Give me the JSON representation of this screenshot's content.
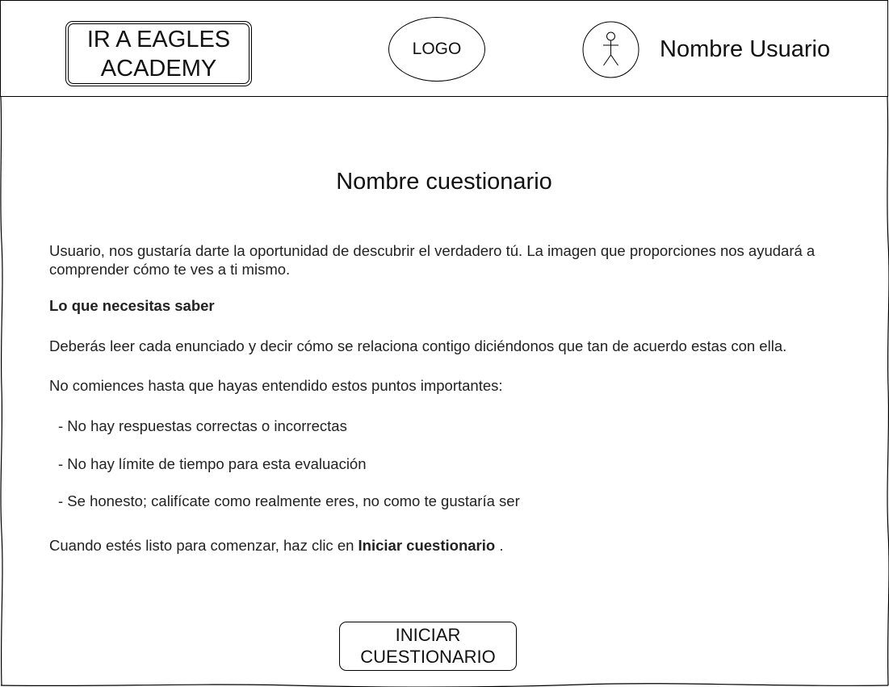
{
  "header": {
    "eagles_button_label": "IR A EAGLES\nACADEMY",
    "logo_text": "LOGO",
    "user_name": "Nombre Usuario",
    "avatar_icon": "stick-figure-user-icon"
  },
  "main": {
    "title": "Nombre cuestionario",
    "intro": "Usuario, nos gustaría darte la oportunidad de descubrir el verdadero tú. La imagen que proporciones nos ayudará a comprender cómo te ves a ti mismo.",
    "heading": "Lo que necesitas saber",
    "instructions": "Deberás leer cada enunciado y decir cómo se relaciona contigo diciéndonos que tan de acuerdo estas con ella.",
    "prelist": "No comiences hasta que hayas entendido estos puntos importantes:",
    "points": [
      "- No hay respuestas correctas o incorrectas",
      "- No hay límite de tiempo para esta evaluación",
      "- Se honesto; califícate como realmente eres, no como te gustaría ser"
    ],
    "final_prefix": "Cuando estés listo para comenzar, haz clic en ",
    "final_bold": "Iniciar cuestionario",
    "final_suffix": " .",
    "start_button_label": "INICIAR\nCUESTIONARIO"
  }
}
